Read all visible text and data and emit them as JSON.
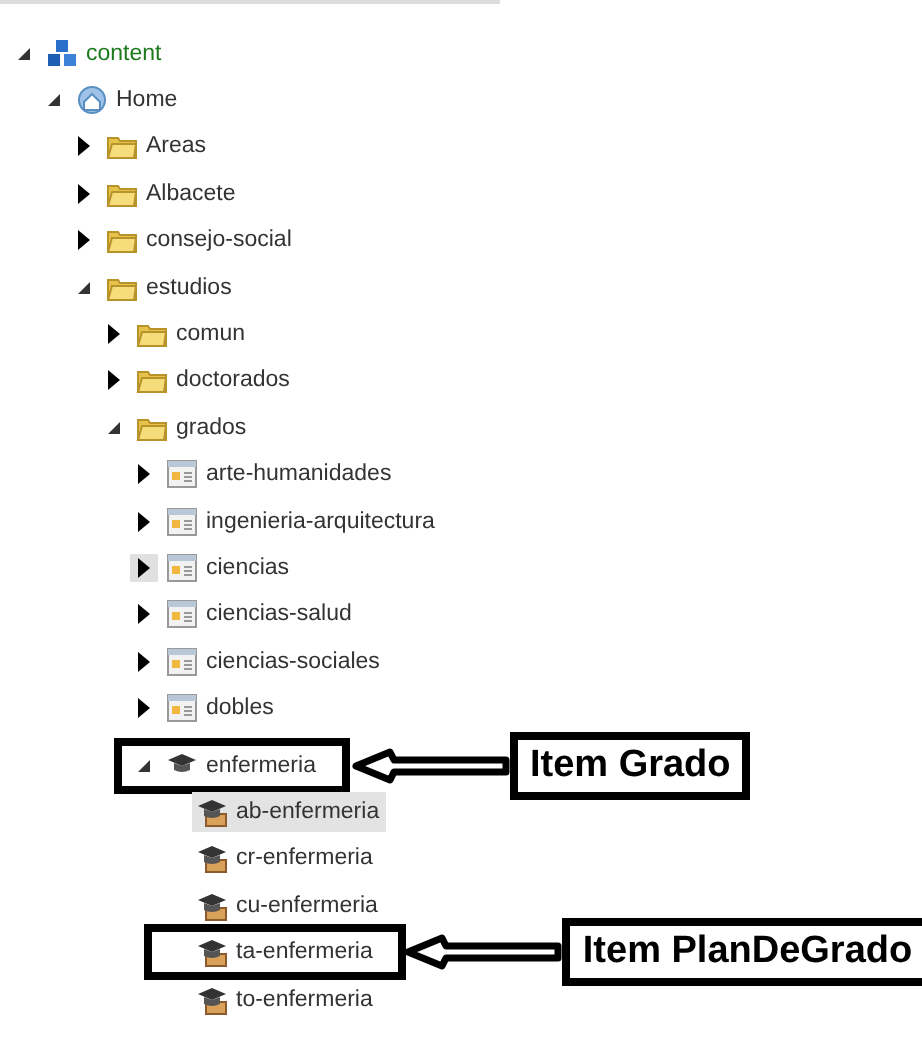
{
  "tree": [
    {
      "label": "content",
      "kind": "database",
      "expanded": true,
      "toggle_hover": false,
      "selected": false,
      "children": [
        {
          "label": "Home",
          "kind": "site",
          "expanded": true,
          "toggle_hover": false,
          "selected": false,
          "children": [
            {
              "label": "Areas",
              "kind": "folder",
              "expanded": false,
              "toggle_hover": false,
              "selected": false
            },
            {
              "label": "Albacete",
              "kind": "folder",
              "expanded": false,
              "toggle_hover": false,
              "selected": false
            },
            {
              "label": "consejo-social",
              "kind": "folder",
              "expanded": false,
              "toggle_hover": false,
              "selected": false
            },
            {
              "label": "estudios",
              "kind": "folder",
              "expanded": true,
              "toggle_hover": false,
              "selected": false,
              "children": [
                {
                  "label": "comun",
                  "kind": "folder",
                  "expanded": false,
                  "toggle_hover": false,
                  "selected": false
                },
                {
                  "label": "doctorados",
                  "kind": "folder",
                  "expanded": false,
                  "toggle_hover": false,
                  "selected": false
                },
                {
                  "label": "grados",
                  "kind": "folder",
                  "expanded": true,
                  "toggle_hover": false,
                  "selected": false,
                  "children": [
                    {
                      "label": "arte-humanidades",
                      "kind": "page",
                      "expanded": false,
                      "toggle_hover": false,
                      "selected": false
                    },
                    {
                      "label": "ingenieria-arquitectura",
                      "kind": "page",
                      "expanded": false,
                      "toggle_hover": false,
                      "selected": false
                    },
                    {
                      "label": "ciencias",
                      "kind": "page",
                      "expanded": false,
                      "toggle_hover": true,
                      "selected": false
                    },
                    {
                      "label": "ciencias-salud",
                      "kind": "page",
                      "expanded": false,
                      "toggle_hover": false,
                      "selected": false
                    },
                    {
                      "label": "ciencias-sociales",
                      "kind": "page",
                      "expanded": false,
                      "toggle_hover": false,
                      "selected": false
                    },
                    {
                      "label": "dobles",
                      "kind": "page",
                      "expanded": false,
                      "toggle_hover": false,
                      "selected": false
                    },
                    {
                      "label": "enfermeria",
                      "kind": "degree",
                      "expanded": true,
                      "toggle_hover": false,
                      "selected": false,
                      "callout": "Item Grado",
                      "children": [
                        {
                          "label": "ab-enfermeria",
                          "kind": "plan",
                          "selected": true
                        },
                        {
                          "label": "cr-enfermeria",
                          "kind": "plan",
                          "selected": false
                        },
                        {
                          "label": "cu-enfermeria",
                          "kind": "plan",
                          "selected": false
                        },
                        {
                          "label": "ta-enfermeria",
                          "kind": "plan",
                          "selected": false,
                          "callout": "Item PlanDeGrado"
                        },
                        {
                          "label": "to-enfermeria",
                          "kind": "plan",
                          "selected": false
                        }
                      ]
                    }
                  ]
                }
              ]
            }
          ]
        }
      ]
    }
  ]
}
